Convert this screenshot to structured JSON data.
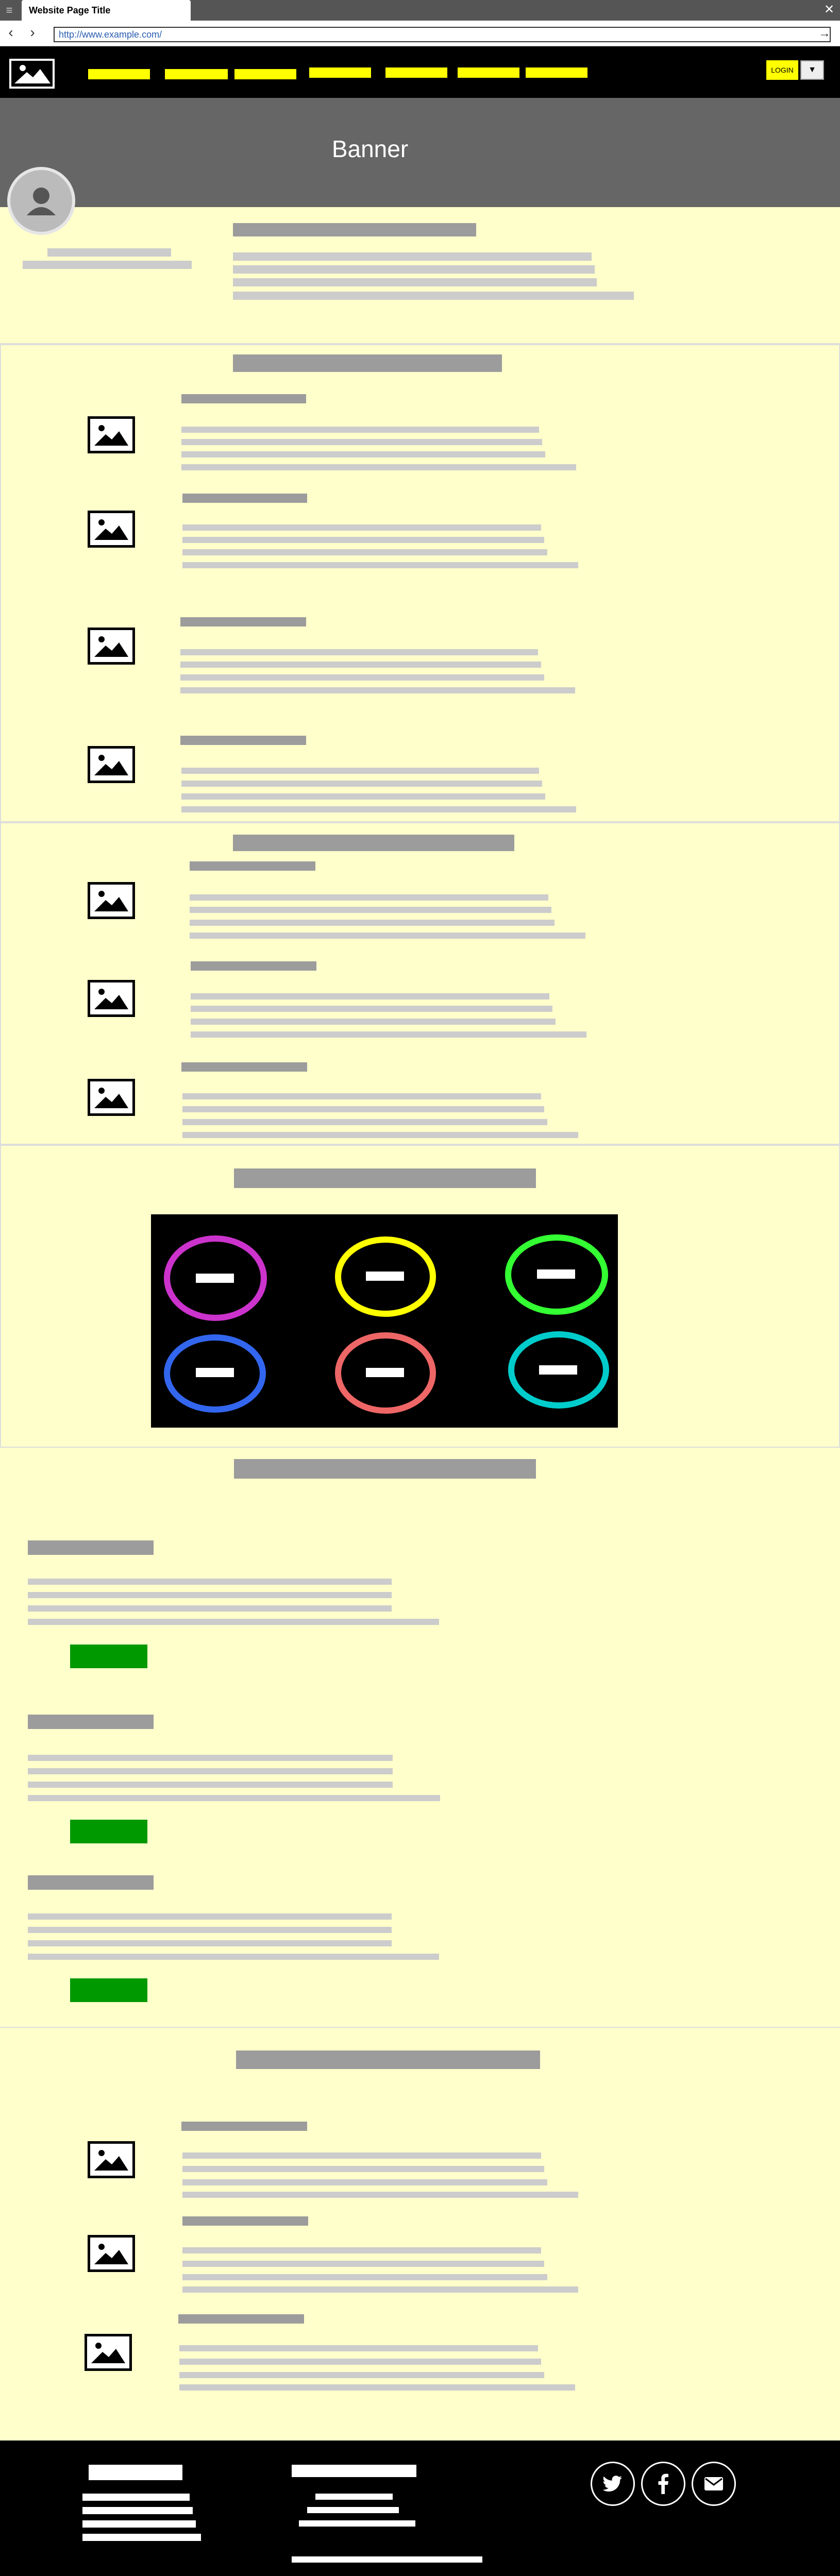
{
  "browser": {
    "tab_title": "Website Page Title",
    "url": "http://www.example.com/",
    "menu_icon": "hamburger-icon",
    "close_icon": "close-icon",
    "back_icon": "back-arrow-icon",
    "forward_icon": "forward-arrow-icon",
    "go_icon": "go-arrow-icon"
  },
  "header": {
    "logo_icon": "image-placeholder-icon",
    "nav_link_count_visible": 7,
    "login_label": "LOGIN",
    "dropdown_icon": "caret-down-icon"
  },
  "banner": {
    "title": "Banner",
    "avatar_icon": "user-avatar-icon"
  },
  "colors": {
    "page_background": "#ffffcc",
    "navbar": "#000000",
    "nav_links": "#ffff00",
    "banner": "#666666",
    "button_green": "#009900",
    "ring_colors": [
      "#cc33cc",
      "#ffff00",
      "#33ff33",
      "#3366ee",
      "#ee6666",
      "#00cccc"
    ]
  },
  "gallery": {
    "icon_names": [
      "magenta-ring-icon",
      "yellow-ring-icon",
      "green-ring-icon",
      "blue-ring-icon",
      "red-ring-icon",
      "cyan-ring-icon"
    ]
  },
  "footer": {
    "social_icons": [
      "twitter-icon",
      "facebook-icon",
      "email-icon"
    ]
  }
}
